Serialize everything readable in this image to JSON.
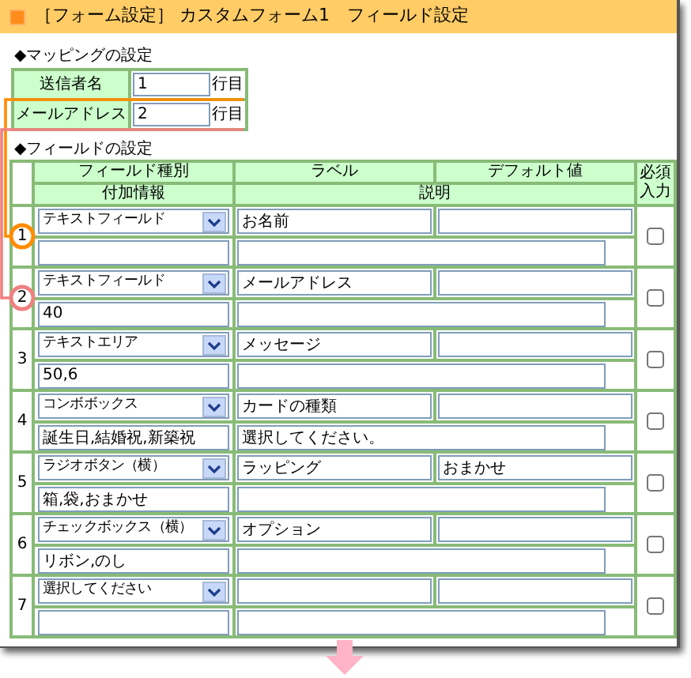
{
  "title": "［フォーム設定］ カスタムフォーム1　フィールド設定",
  "mapping": {
    "heading": "◆マッピングの設定",
    "items": [
      {
        "label": "送信者名",
        "value": "1",
        "unit": "行目",
        "color": "#ff8c00"
      },
      {
        "label": "メールアドレス",
        "value": "2",
        "unit": "行目",
        "color": "#f08080"
      }
    ]
  },
  "fields": {
    "heading": "◆フィールドの設定",
    "columns": [
      "フィールド種別",
      "ラベル",
      "デフォルト値",
      "必須入力"
    ],
    "sub_columns": [
      "付加情報",
      "説明"
    ],
    "rows": [
      {
        "number": "1",
        "type": "テキストフィールド",
        "label": "お名前",
        "default": "",
        "extra": "",
        "description": "",
        "required": false
      },
      {
        "number": "2",
        "type": "テキストフィールド",
        "label": "メールアドレス",
        "default": "",
        "extra": "40",
        "description": "",
        "required": false
      },
      {
        "number": "3",
        "type": "テキストエリア",
        "label": "メッセージ",
        "default": "",
        "extra": "50,6",
        "description": "",
        "required": false
      },
      {
        "number": "4",
        "type": "コンボボックス",
        "label": "カードの種類",
        "default": "",
        "extra": "誕生日,結婚祝,新築祝",
        "description": "選択してください。",
        "required": false
      },
      {
        "number": "5",
        "type": "ラジオボタン（横）",
        "label": "ラッピング",
        "default": "おまかせ",
        "extra": "箱,袋,おまかせ",
        "description": "",
        "required": false
      },
      {
        "number": "6",
        "type": "チェックボックス（横）",
        "label": "オプション",
        "default": "",
        "extra": "リボン,のし",
        "description": "",
        "required": false
      },
      {
        "number": "7",
        "type": "選択してください",
        "label": "",
        "default": "",
        "extra": "",
        "description": "",
        "required": false
      }
    ]
  }
}
